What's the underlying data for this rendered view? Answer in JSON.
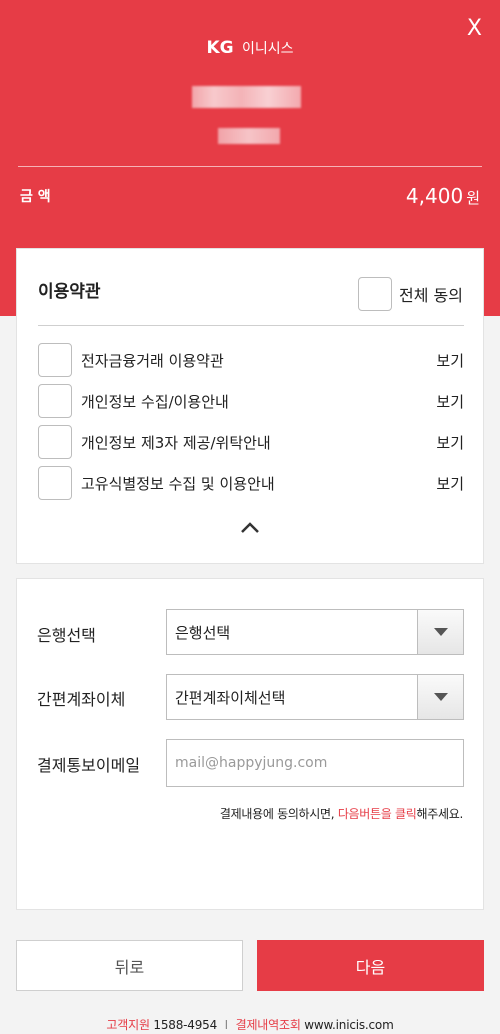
{
  "header": {
    "close_label": "X",
    "logo_brand": "KG",
    "logo_text": "이니시스",
    "amount_label": "금 액",
    "amount_value": "4,400",
    "amount_unit": "원",
    "accent_color": "#e63c46"
  },
  "terms": {
    "title": "이용약관",
    "agree_all_label": "전체 동의",
    "items": [
      {
        "label": "전자금융거래 이용약관",
        "view": "보기"
      },
      {
        "label": "개인정보 수집/이용안내",
        "view": "보기"
      },
      {
        "label": "개인정보 제3자 제공/위탁안내",
        "view": "보기"
      },
      {
        "label": "고유식별정보 수집 및 이용안내",
        "view": "보기"
      }
    ]
  },
  "payment": {
    "bank_label": "은행선택",
    "bank_selected": "은행선택",
    "easy_transfer_label": "간편계좌이체",
    "easy_transfer_selected": "간편계좌이체선택",
    "email_label": "결제통보이메일",
    "email_placeholder": "mail@happyjung.com",
    "notice_prefix": "결제내용에 동의하시면,",
    "notice_highlight": "다음버튼을 클릭",
    "notice_suffix": "해주세요."
  },
  "buttons": {
    "back_label": "뒤로",
    "next_label": "다음"
  },
  "footer": {
    "support_label": "고객지원",
    "support_phone": "1588-4954",
    "divider": "I",
    "history_label": "결제내역조회",
    "site": "www.inicis.com"
  }
}
